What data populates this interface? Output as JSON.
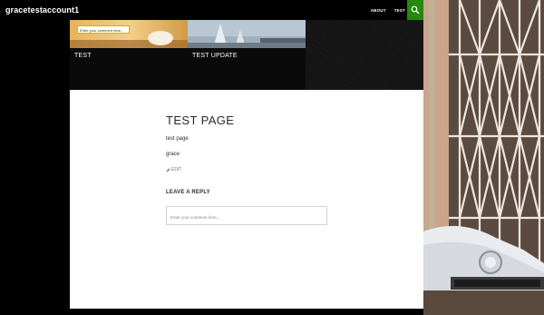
{
  "site": {
    "title": "gracetestaccount1"
  },
  "nav": {
    "items": [
      "ABOUT",
      "TEST"
    ]
  },
  "icons": {
    "search": "search-icon",
    "edit": "pencil-icon"
  },
  "featured": [
    {
      "label": "TEST"
    },
    {
      "label": "TEST UPDATE"
    }
  ],
  "featured_tooltip": "Enter your comment here...",
  "page": {
    "title": "TEST PAGE",
    "paragraphs": [
      "test page",
      "grace"
    ],
    "edit_label": "EDIT"
  },
  "comments": {
    "title": "LEAVE A REPLY",
    "placeholder": "Enter your comment here..."
  },
  "colors": {
    "accent": "#24890d",
    "header_bg": "#000000",
    "content_bg": "#ffffff"
  }
}
